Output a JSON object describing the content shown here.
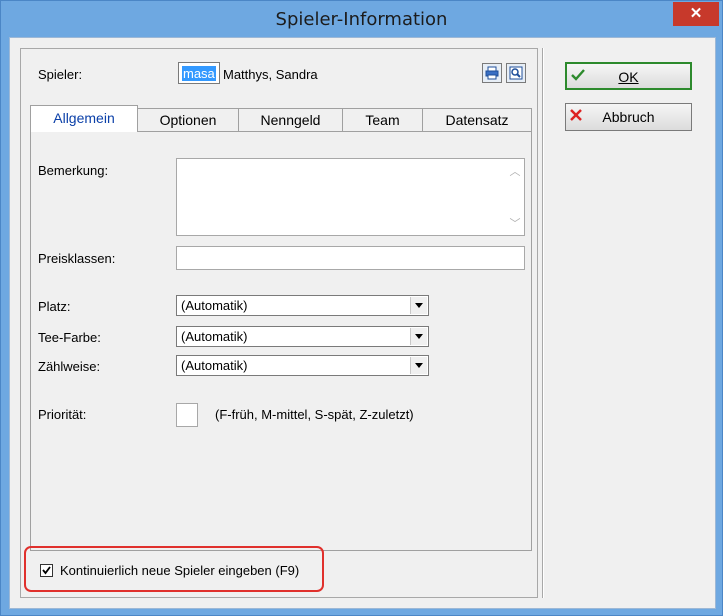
{
  "window": {
    "title": "Spieler-Information",
    "close_glyph": "✕"
  },
  "player": {
    "label": "Spieler:",
    "code": "masa",
    "name": "Matthys, Sandra"
  },
  "toolbar": {
    "print_icon": "printer-icon",
    "search_icon": "search-icon"
  },
  "tabs": [
    {
      "label": "Allgemein",
      "active": true
    },
    {
      "label": "Optionen"
    },
    {
      "label": "Nenngeld"
    },
    {
      "label": "Team"
    },
    {
      "label": "Datensatz"
    }
  ],
  "form": {
    "bemerkung_label": "Bemerkung:",
    "bemerkung_value": "",
    "preisklassen_label": "Preisklassen:",
    "preisklassen_value": "",
    "platz_label": "Platz:",
    "platz_value": "(Automatik)",
    "tee_label": "Tee-Farbe:",
    "tee_value": "(Automatik)",
    "zaehl_label": "Zählweise:",
    "zaehl_value": "(Automatik)",
    "prio_label": "Priorität:",
    "prio_value": "",
    "prio_hint": "(F-früh, M-mittel, S-spät, Z-zuletzt)"
  },
  "checkbox": {
    "label": "Kontinuierlich neue Spieler eingeben (F9)",
    "checked": true
  },
  "buttons": {
    "ok": "OK",
    "cancel": "Abbruch"
  },
  "colors": {
    "accent": "#0a3fa8",
    "highlight": "#e0302c",
    "ok_border": "#2d8a2d",
    "close": "#c7392b"
  }
}
